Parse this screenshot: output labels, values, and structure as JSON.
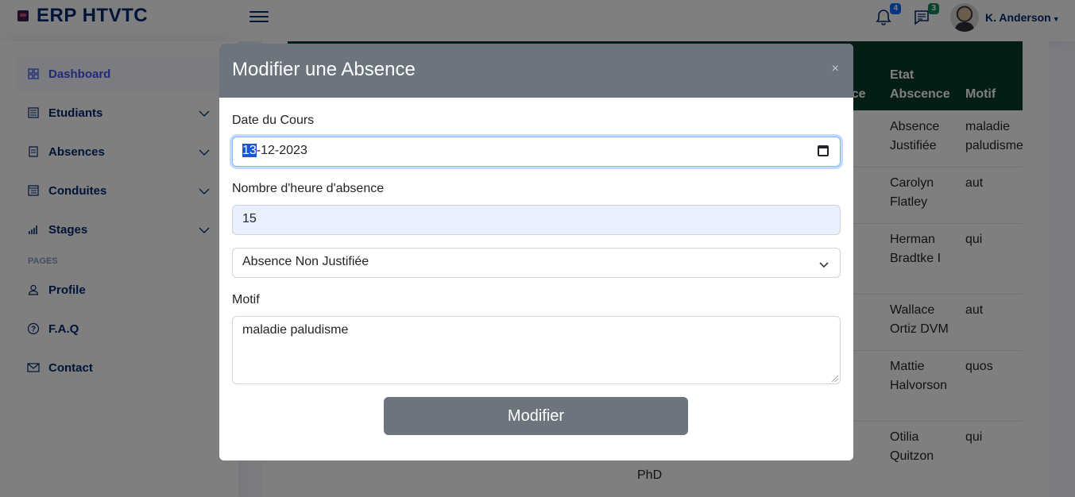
{
  "header": {
    "logo_text": "ERP HTVTC",
    "notifications_count": "4",
    "messages_count": "3",
    "user_name": "K. Anderson",
    "badge_colors": {
      "notifications": "#0d6efd",
      "messages": "#198754"
    }
  },
  "sidebar": {
    "items": [
      {
        "label": "Dashboard",
        "icon": "grid-icon",
        "active": true
      },
      {
        "label": "Etudiants",
        "icon": "layout-text-icon",
        "expandable": true
      },
      {
        "label": "Absences",
        "icon": "journal-text-icon",
        "expandable": true
      },
      {
        "label": "Conduites",
        "icon": "layout-text-window-icon",
        "expandable": true
      },
      {
        "label": "Stages",
        "icon": "bar-chart-icon",
        "expandable": true
      }
    ],
    "heading": "PAGES",
    "pages": [
      {
        "label": "Profile",
        "icon": "person-icon"
      },
      {
        "label": "F.A.Q",
        "icon": "question-circle-icon"
      },
      {
        "label": "Contact",
        "icon": "envelope-icon"
      }
    ]
  },
  "table": {
    "headers": [
      "nce",
      "Etat Abscence",
      "Motif"
    ],
    "rows": [
      {
        "etat": "Absence Justifiée",
        "motif": "maladie paludisme"
      },
      {
        "etat": "Carolyn Flatley",
        "motif": "aut"
      },
      {
        "etat": "Herman Bradtke I",
        "motif": "qui"
      },
      {
        "etat": "Wallace Ortiz DVM",
        "motif": "aut"
      },
      {
        "etat": "Mattie Halvorson",
        "motif": "quos"
      },
      {
        "etat": "Otilia Quitzon",
        "motif": "qui"
      }
    ],
    "partial_cells": [
      "PhD"
    ]
  },
  "modal": {
    "title": "Modifier une Absence",
    "close_symbol": "×",
    "date_label": "Date du Cours",
    "date_day": "13",
    "date_rest": "-12-2023",
    "hours_label": "Nombre d'heure d'absence",
    "hours_value": "15",
    "status_value": "Absence Non Justifiée",
    "motif_label": "Motif",
    "motif_value": "maladie paludisme",
    "submit_label": "Modifier"
  }
}
